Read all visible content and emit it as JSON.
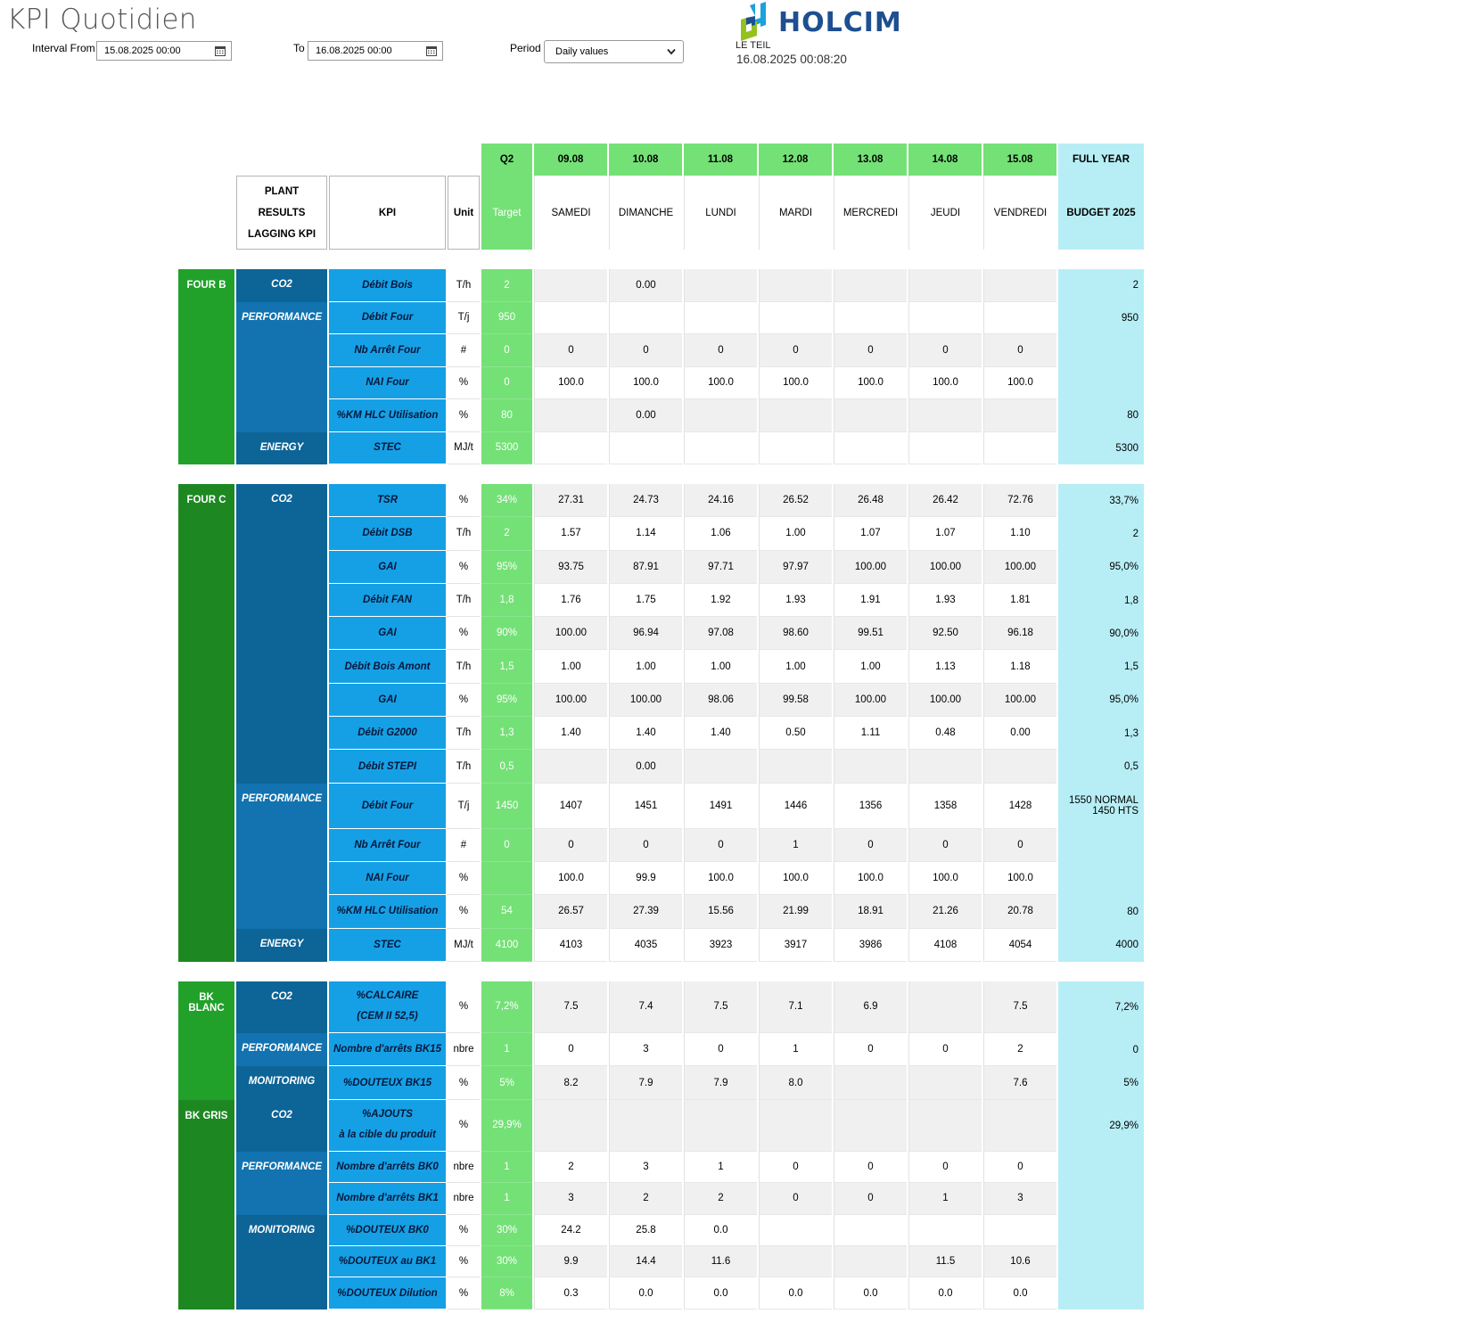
{
  "header": {
    "title": "KPI Quotidien",
    "interval_from_label": "Interval From",
    "interval_from_value": "15.08.2025 00:00",
    "to_label": "To",
    "to_value": "16.08.2025 00:00",
    "period_label": "Period",
    "period_value": "Daily values",
    "brand": "HOLCIM",
    "plant": "LE TEIL",
    "timestamp": "16.08.2025 00:08:20"
  },
  "table": {
    "q2_label": "Q2",
    "target_label": "Target",
    "full_year_label": "FULL YEAR",
    "budget_label": "BUDGET 2025",
    "plant_results": [
      "PLANT",
      "RESULTS",
      "LAGGING KPI"
    ],
    "kpi_header": "KPI",
    "unit_header": "Unit",
    "dates": [
      "09.08",
      "10.08",
      "11.08",
      "12.08",
      "13.08",
      "14.08",
      "15.08"
    ],
    "weekdays": [
      "SAMEDI",
      "DIMANCHE",
      "LUNDI",
      "MARDI",
      "MERCREDI",
      "JEUDI",
      "VENDREDI"
    ],
    "groups": [
      {
        "name": "FOUR B",
        "sections": [
          {
            "name": "CO2",
            "rows": [
              {
                "kpi": "Débit Bois",
                "unit": "T/h",
                "target": "2",
                "values": [
                  "",
                  "0.00",
                  "",
                  "",
                  "",
                  "",
                  ""
                ],
                "budget": "2"
              }
            ]
          },
          {
            "name": "PERFORMANCE",
            "rows": [
              {
                "kpi": "Débit Four",
                "unit": "T/j",
                "target": "950",
                "values": [
                  "",
                  "",
                  "",
                  "",
                  "",
                  "",
                  ""
                ],
                "budget": "950"
              },
              {
                "kpi": "Nb Arrêt Four",
                "unit": "#",
                "target": "0",
                "values": [
                  "0",
                  "0",
                  "0",
                  "0",
                  "0",
                  "0",
                  "0"
                ],
                "budget": ""
              },
              {
                "kpi": "NAI Four",
                "unit": "%",
                "target": "0",
                "values": [
                  "100.0",
                  "100.0",
                  "100.0",
                  "100.0",
                  "100.0",
                  "100.0",
                  "100.0"
                ],
                "budget": ""
              },
              {
                "kpi": "%KM  HLC Utilisation",
                "unit": "%",
                "target": "80",
                "values": [
                  "",
                  "0.00",
                  "",
                  "",
                  "",
                  "",
                  ""
                ],
                "budget": "80"
              }
            ]
          },
          {
            "name": "ENERGY",
            "rows": [
              {
                "kpi": "STEC",
                "unit": "MJ/t",
                "target": "5300",
                "values": [
                  "",
                  "",
                  "",
                  "",
                  "",
                  "",
                  ""
                ],
                "budget": "5300"
              }
            ]
          }
        ]
      },
      {
        "name": "FOUR C",
        "sections": [
          {
            "name": "CO2",
            "rows": [
              {
                "kpi": "TSR",
                "unit": "%",
                "target": "34%",
                "values": [
                  "27.31",
                  "24.73",
                  "24.16",
                  "26.52",
                  "26.48",
                  "26.42",
                  "72.76"
                ],
                "budget": "33,7%"
              },
              {
                "kpi": "Débit DSB",
                "unit": "T/h",
                "target": "2",
                "values": [
                  "1.57",
                  "1.14",
                  "1.06",
                  "1.00",
                  "1.07",
                  "1.07",
                  "1.10"
                ],
                "budget": "2"
              },
              {
                "kpi": "GAI",
                "unit": "%",
                "target": "95%",
                "values": [
                  "93.75",
                  "87.91",
                  "97.71",
                  "97.97",
                  "100.00",
                  "100.00",
                  "100.00"
                ],
                "budget": "95,0%"
              },
              {
                "kpi": "Débit FAN",
                "unit": "T/h",
                "target": "1,8",
                "values": [
                  "1.76",
                  "1.75",
                  "1.92",
                  "1.93",
                  "1.91",
                  "1.93",
                  "1.81"
                ],
                "budget": "1,8"
              },
              {
                "kpi": "GAI",
                "unit": "%",
                "target": "90%",
                "values": [
                  "100.00",
                  "96.94",
                  "97.08",
                  "98.60",
                  "99.51",
                  "92.50",
                  "96.18"
                ],
                "budget": "90,0%"
              },
              {
                "kpi": "Débit Bois Amont",
                "unit": "T/h",
                "target": "1,5",
                "values": [
                  "1.00",
                  "1.00",
                  "1.00",
                  "1.00",
                  "1.00",
                  "1.13",
                  "1.18"
                ],
                "budget": "1,5"
              },
              {
                "kpi": "GAI",
                "unit": "%",
                "target": "95%",
                "values": [
                  "100.00",
                  "100.00",
                  "98.06",
                  "99.58",
                  "100.00",
                  "100.00",
                  "100.00"
                ],
                "budget": "95,0%"
              },
              {
                "kpi": "Débit G2000",
                "unit": "T/h",
                "target": "1,3",
                "values": [
                  "1.40",
                  "1.40",
                  "1.40",
                  "0.50",
                  "1.11",
                  "0.48",
                  "0.00"
                ],
                "budget": "1,3"
              },
              {
                "kpi": "Débit STEPI",
                "unit": "T/h",
                "target": "0,5",
                "values": [
                  "",
                  "0.00",
                  "",
                  "",
                  "",
                  "",
                  ""
                ],
                "budget": "0,5"
              }
            ]
          },
          {
            "name": "PERFORMANCE",
            "rows": [
              {
                "kpi": "Débit Four",
                "unit": "T/j",
                "target": "1450",
                "values": [
                  "1407",
                  "1451",
                  "1491",
                  "1446",
                  "1356",
                  "1358",
                  "1428"
                ],
                "budget": "1550 NORMAL",
                "budget2": "1450 HTS"
              },
              {
                "kpi": "Nb Arrêt Four",
                "unit": "#",
                "target": "0",
                "values": [
                  "0",
                  "0",
                  "0",
                  "1",
                  "0",
                  "0",
                  "0"
                ],
                "budget": ""
              },
              {
                "kpi": "NAI Four",
                "unit": "%",
                "target": "",
                "values": [
                  "100.0",
                  "99.9",
                  "100.0",
                  "100.0",
                  "100.0",
                  "100.0",
                  "100.0"
                ],
                "budget": ""
              },
              {
                "kpi": "%KM  HLC Utilisation",
                "unit": "%",
                "target": "54",
                "values": [
                  "26.57",
                  "27.39",
                  "15.56",
                  "21.99",
                  "18.91",
                  "21.26",
                  "20.78"
                ],
                "budget": "80"
              }
            ]
          },
          {
            "name": "ENERGY",
            "rows": [
              {
                "kpi": "STEC",
                "unit": "MJ/t",
                "target": "4100",
                "values": [
                  "4103",
                  "4035",
                  "3923",
                  "3917",
                  "3986",
                  "4108",
                  "4054"
                ],
                "budget": "4000"
              }
            ]
          }
        ]
      },
      {
        "name": "BK",
        "name2": "BLANC",
        "sections": [
          {
            "name": "CO2",
            "rows": [
              {
                "kpi": "%CALCAIRE",
                "kpi2": "(CEM II 52,5)",
                "unit": "%",
                "target": "7,2%",
                "values": [
                  "7.5",
                  "7.4",
                  "7.5",
                  "7.1",
                  "6.9",
                  "",
                  "7.5"
                ],
                "budget": "7,2%"
              }
            ]
          },
          {
            "name": "PERFORMANCE",
            "rows": [
              {
                "kpi": "Nombre d'arrêts BK15",
                "unit": "nbre",
                "target": "1",
                "values": [
                  "0",
                  "3",
                  "0",
                  "1",
                  "0",
                  "0",
                  "2"
                ],
                "budget": "0"
              }
            ]
          },
          {
            "name": "MONITORING",
            "rows": [
              {
                "kpi": "%DOUTEUX BK15",
                "unit": "%",
                "target": "5%",
                "values": [
                  "8.2",
                  "7.9",
                  "7.9",
                  "8.0",
                  "",
                  "",
                  "7.6"
                ],
                "budget": "5%"
              }
            ]
          }
        ]
      },
      {
        "name": "BK GRIS",
        "sections": [
          {
            "name": "CO2",
            "rows": [
              {
                "kpi": "%AJOUTS",
                "kpi2": "à la cible du produit",
                "unit": "%",
                "target": "29,9%",
                "values": [
                  "",
                  "",
                  "",
                  "",
                  "",
                  "",
                  ""
                ],
                "budget": "29,9%"
              }
            ]
          },
          {
            "name": "PERFORMANCE",
            "rows": [
              {
                "kpi": "Nombre d'arrêts BK0",
                "unit": "nbre",
                "target": "1",
                "values": [
                  "2",
                  "3",
                  "1",
                  "0",
                  "0",
                  "0",
                  "0"
                ],
                "budget": ""
              },
              {
                "kpi": "Nombre d'arrêts BK1",
                "unit": "nbre",
                "target": "1",
                "values": [
                  "3",
                  "2",
                  "2",
                  "0",
                  "0",
                  "1",
                  "3"
                ],
                "budget": ""
              }
            ]
          },
          {
            "name": "MONITORING",
            "rows": [
              {
                "kpi": "%DOUTEUX BK0",
                "unit": "%",
                "target": "30%",
                "values": [
                  "24.2",
                  "25.8",
                  "0.0",
                  "",
                  "",
                  "",
                  ""
                ],
                "budget": ""
              },
              {
                "kpi": "%DOUTEUX au BK1",
                "unit": "%",
                "target": "30%",
                "values": [
                  "9.9",
                  "14.4",
                  "11.6",
                  "",
                  "",
                  "11.5",
                  "10.6"
                ],
                "budget": ""
              },
              {
                "kpi": "%DOUTEUX Dilution",
                "unit": "%",
                "target": "8%",
                "values": [
                  "0.3",
                  "0.0",
                  "0.0",
                  "0.0",
                  "0.0",
                  "0.0",
                  "0.0"
                ],
                "budget": ""
              }
            ]
          }
        ]
      }
    ]
  }
}
